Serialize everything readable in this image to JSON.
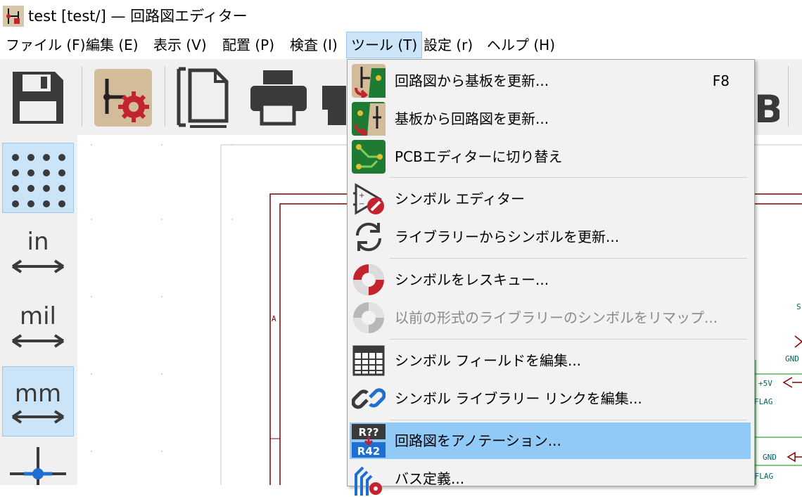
{
  "window": {
    "title": "test [test/] — 回路図エディター"
  },
  "menu": {
    "items": [
      {
        "label": "ファイル (F)"
      },
      {
        "label": "編集 (E)"
      },
      {
        "label": "表示 (V)"
      },
      {
        "label": "配置 (P)"
      },
      {
        "label": "検査 (I)"
      },
      {
        "label": "ツール (T)",
        "active": true
      },
      {
        "label": "設定 (r)"
      },
      {
        "label": "ヘルプ (H)"
      }
    ]
  },
  "toolbar": {
    "icons": [
      "save-icon",
      "schematic-setup-icon",
      "page-settings-icon",
      "print-icon",
      "plot-icon"
    ],
    "partial_glyph": "B"
  },
  "left_toolbar": {
    "grid_icon": "grid-dots-icon",
    "units": [
      {
        "label": "in",
        "selected": false
      },
      {
        "label": "mil",
        "selected": false
      },
      {
        "label": "mm",
        "selected": true
      }
    ],
    "cursor_icon": "cursor-crosshair-icon"
  },
  "canvas": {
    "border_label": "A",
    "labels": {
      "gnd_1": "GND",
      "plus5v": "+5V",
      "flag_1": "FLAG",
      "gnd_2": "GND",
      "flag_2": "_FLAG",
      "s": "S"
    }
  },
  "tools_menu": {
    "items": [
      {
        "label": "回路図から基板を更新...",
        "shortcut": "F8",
        "icon": "update-pcb-icon"
      },
      {
        "label": "基板から回路図を更新...",
        "icon": "update-schematic-icon"
      },
      {
        "label": "PCBエディターに切り替え",
        "icon": "pcb-editor-icon"
      },
      {
        "label": "シンボル エディター",
        "icon": "symbol-editor-icon"
      },
      {
        "label": "ライブラリーからシンボルを更新...",
        "icon": "refresh-icon"
      },
      {
        "label": "シンボルをレスキュー...",
        "icon": "rescue-icon"
      },
      {
        "label": "以前の形式のライブラリーのシンボルをリマップ...",
        "icon": "remap-icon",
        "disabled": true
      },
      {
        "label": "シンボル フィールドを編集...",
        "icon": "table-icon"
      },
      {
        "label": "シンボル ライブラリー リンクを編集...",
        "icon": "link-icon"
      },
      {
        "label": "回路図をアノテーション...",
        "icon": "annotate-icon",
        "highlighted": true,
        "icon_text_top": "R??",
        "icon_text_bottom": "R42"
      },
      {
        "label": "バス定義...",
        "icon": "bus-definition-icon"
      }
    ]
  },
  "colors": {
    "accent_blue": "#cce4f7",
    "highlight": "#91c9f7",
    "schematic_red": "#840000",
    "schematic_green": "#009600",
    "pcb_green": "#1f7a33"
  }
}
